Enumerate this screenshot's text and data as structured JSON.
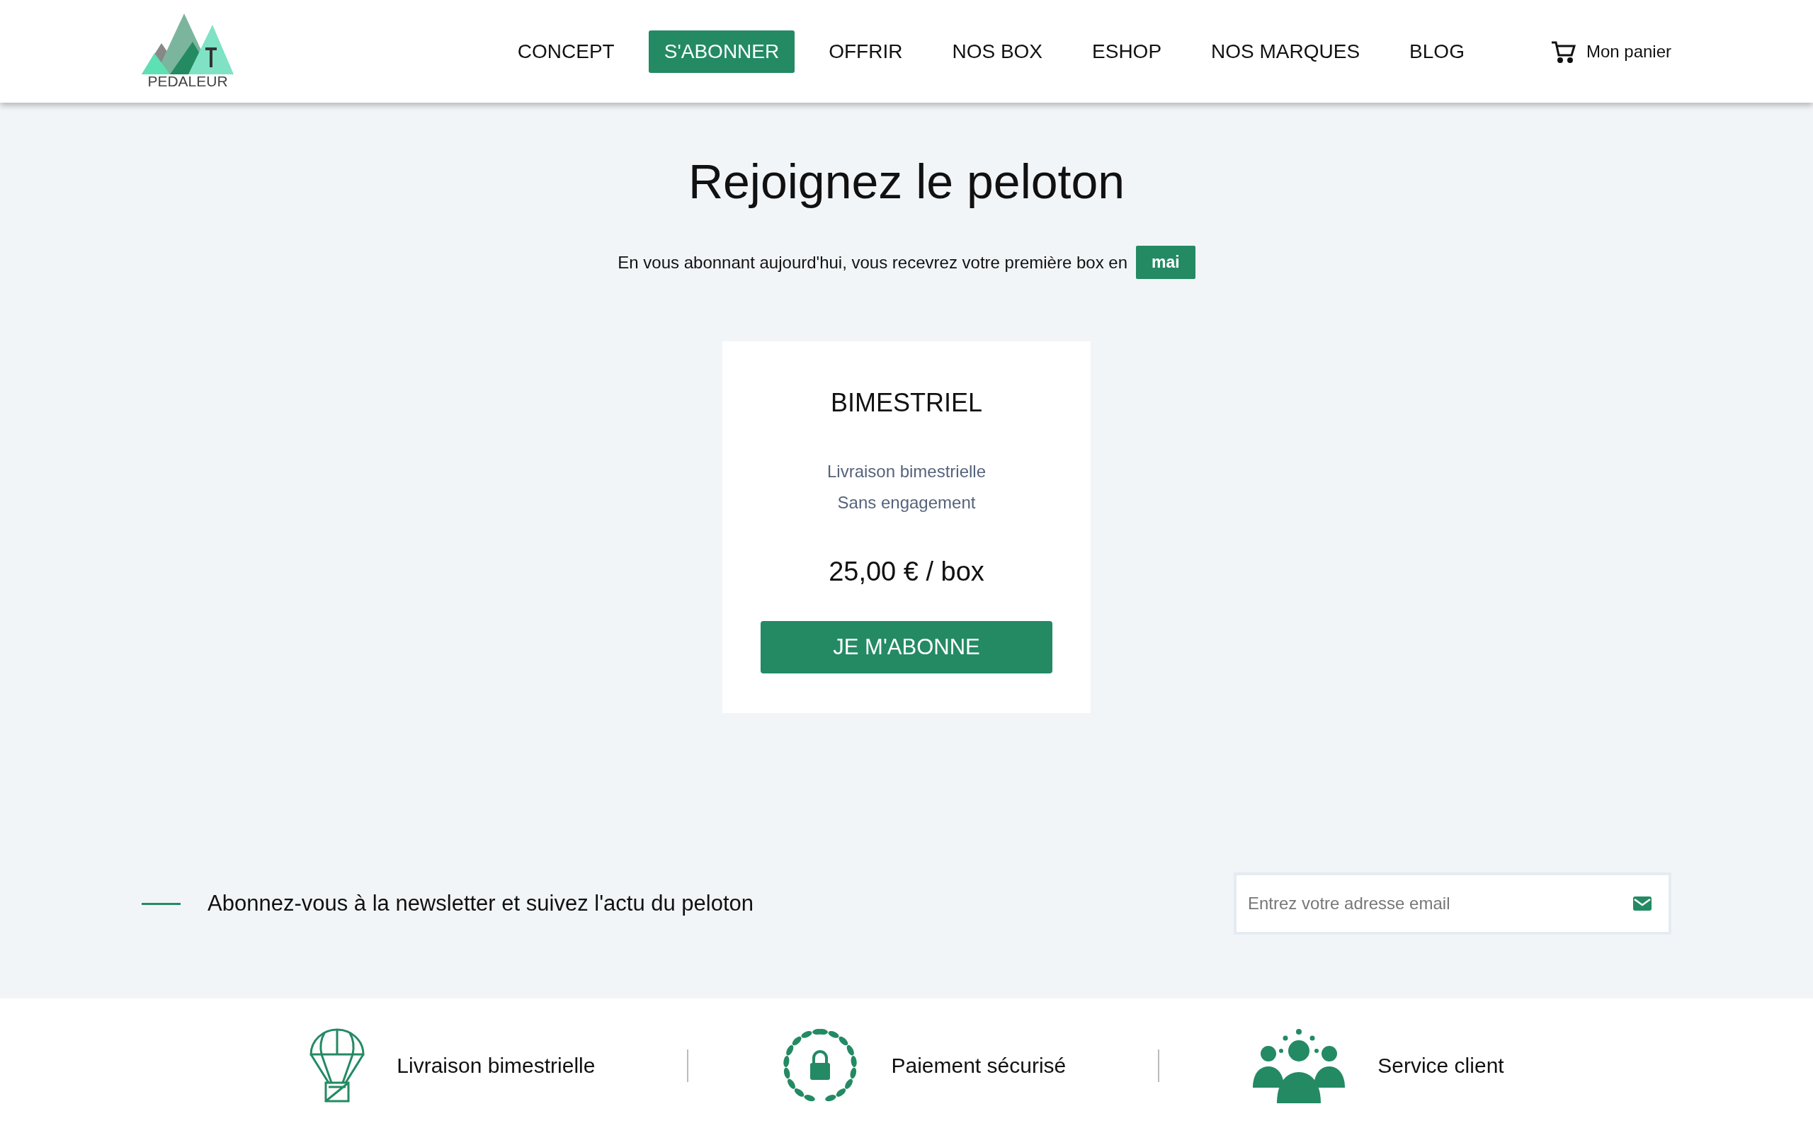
{
  "header": {
    "logo_text": "PEDALEUR",
    "nav": [
      {
        "label": "CONCEPT",
        "selected": false
      },
      {
        "label": "S'ABONNER",
        "selected": true
      },
      {
        "label": "OFFRIR",
        "selected": false
      },
      {
        "label": "NOS BOX",
        "selected": false
      },
      {
        "label": "ESHOP",
        "selected": false
      },
      {
        "label": "NOS MARQUES",
        "selected": false
      },
      {
        "label": "BLOG",
        "selected": false
      }
    ],
    "cart": "Mon panier"
  },
  "hero": {
    "title": "Rejoignez le peloton",
    "subtitle": "En vous abonnant aujourd'hui, vous recevrez votre première box en",
    "month": "mai"
  },
  "plan": {
    "name": "BIMESTRIEL",
    "features": [
      "Livraison bimestrielle",
      "Sans engagement"
    ],
    "price": "25,00 € / box",
    "button": "JE M'ABONNE"
  },
  "newsletter": {
    "text": "Abonnez-vous à la newsletter et suivez l'actu du peloton",
    "placeholder": "Entrez votre adresse email"
  },
  "features": [
    {
      "kind": "parachute",
      "label": "Livraison bimestrielle"
    },
    {
      "kind": "lock",
      "label": "Paiement sécurisé"
    },
    {
      "kind": "team",
      "label": "Service client"
    }
  ]
}
